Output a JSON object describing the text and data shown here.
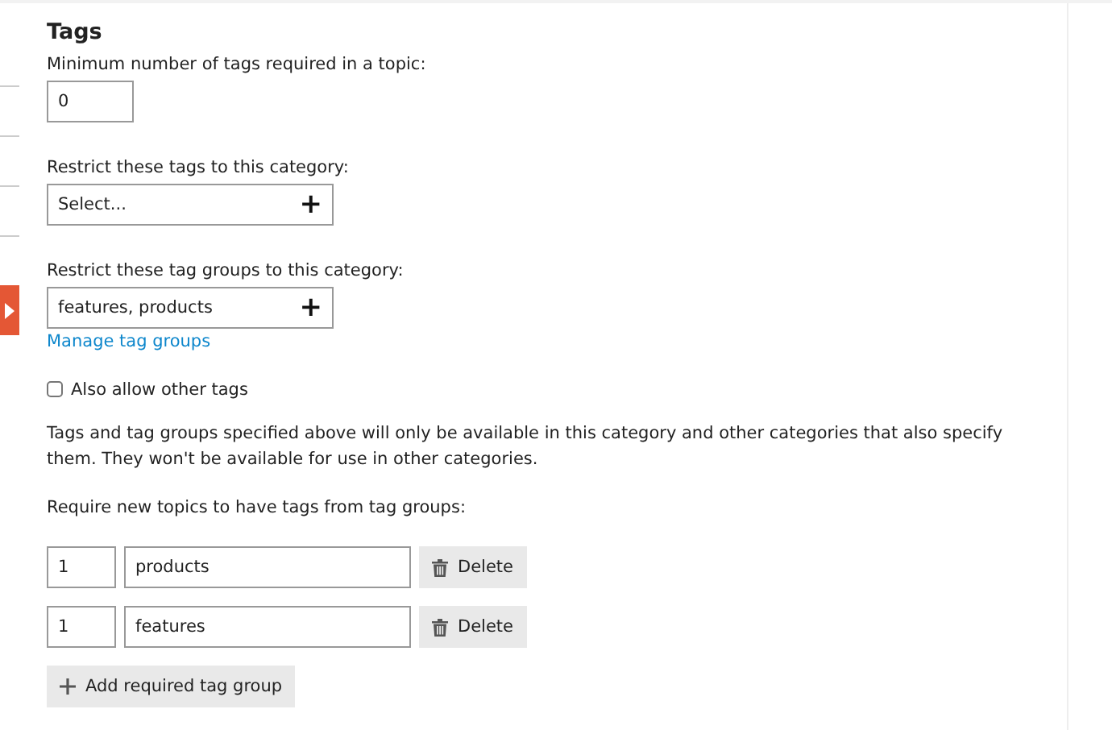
{
  "section_title": "Tags",
  "min_tags": {
    "label": "Minimum number of tags required in a topic:",
    "value": "0"
  },
  "restrict_tags": {
    "label": "Restrict these tags to this category:",
    "placeholder": "Select...",
    "add_icon": "+"
  },
  "restrict_tag_groups": {
    "label": "Restrict these tag groups to this category:",
    "value": "features, products",
    "add_icon": "+",
    "link": "Manage tag groups"
  },
  "allow_other_tags": {
    "label": "Also allow other tags",
    "checked": false
  },
  "note": "Tags and tag groups specified above will only be available in this category and other categories that also specify them. They won't be available for use in other categories.",
  "required_groups": {
    "label": "Require new topics to have tags from tag groups:",
    "rows": [
      {
        "count": "1",
        "group": "products",
        "delete": "Delete"
      },
      {
        "count": "1",
        "group": "features",
        "delete": "Delete"
      }
    ],
    "add_button": "Add required tag group"
  }
}
